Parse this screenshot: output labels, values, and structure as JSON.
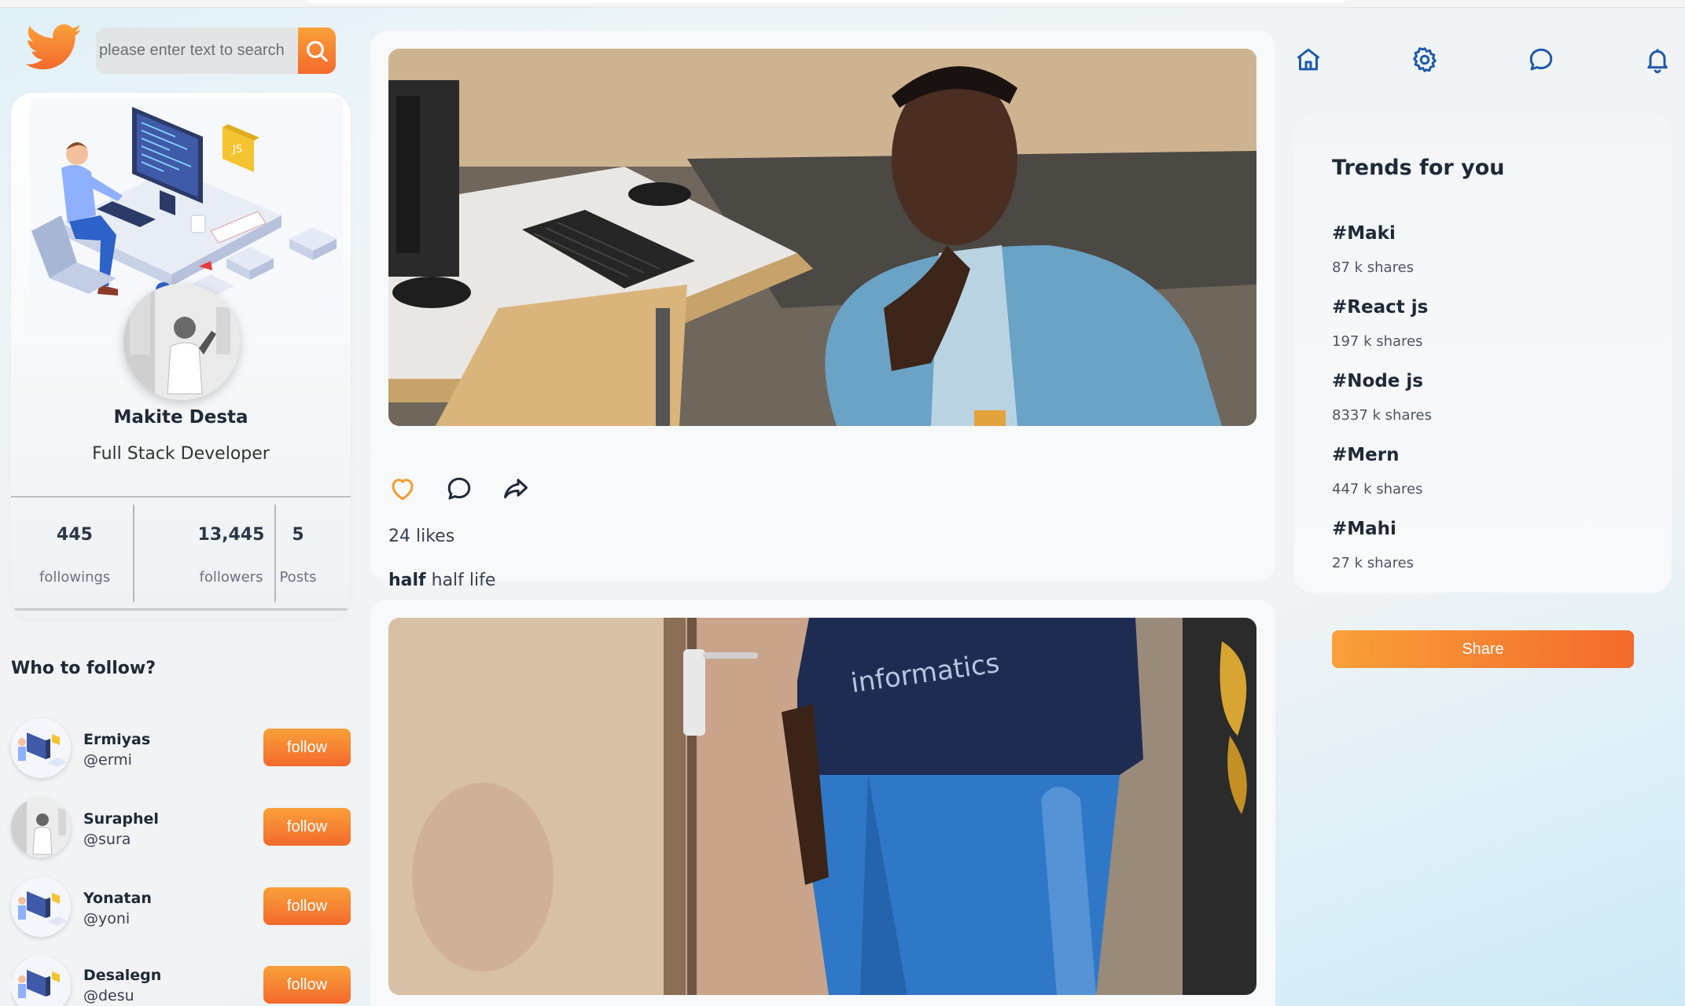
{
  "search": {
    "placeholder": "please enter text to search"
  },
  "profile": {
    "name": "Makite Desta",
    "role": "Full Stack Developer",
    "stats": [
      {
        "value": "445",
        "label": "followings"
      },
      {
        "value": "13,445",
        "label": "followers"
      },
      {
        "value": "5",
        "label": "Posts"
      }
    ],
    "cover_badge": "JS"
  },
  "who_to_follow": {
    "title": "Who to follow?",
    "users": [
      {
        "name": "Ermiyas",
        "handle": "@ermi",
        "button": "follow"
      },
      {
        "name": "Suraphel",
        "handle": "@sura",
        "button": "follow"
      },
      {
        "name": "Yonatan",
        "handle": "@yoni",
        "button": "follow"
      },
      {
        "name": "Desalegn",
        "handle": "@desu",
        "button": "follow"
      }
    ]
  },
  "posts": [
    {
      "likes": "24 likes",
      "author": "half",
      "text": "half life"
    },
    {
      "shirt_text": "informatics"
    }
  ],
  "trends": {
    "title": "Trends for you",
    "items": [
      {
        "tag": "#Maki",
        "shares": "87 k shares"
      },
      {
        "tag": "#React js",
        "shares": "197 k shares"
      },
      {
        "tag": "#Node js",
        "shares": "8337 k shares"
      },
      {
        "tag": "#Mern",
        "shares": "447 k shares"
      },
      {
        "tag": "#Mahi",
        "shares": "27 k shares"
      }
    ]
  },
  "share_button": "Share",
  "colors": {
    "accent_start": "#f9a03a",
    "accent_end": "#f36a2c",
    "nav_icon": "#1e5aa8"
  },
  "icons": [
    "twitter-bird-icon",
    "search-icon",
    "home-icon",
    "gear-icon",
    "chat-icon",
    "bell-icon",
    "heart-icon",
    "comment-icon",
    "share-arrow-icon"
  ]
}
